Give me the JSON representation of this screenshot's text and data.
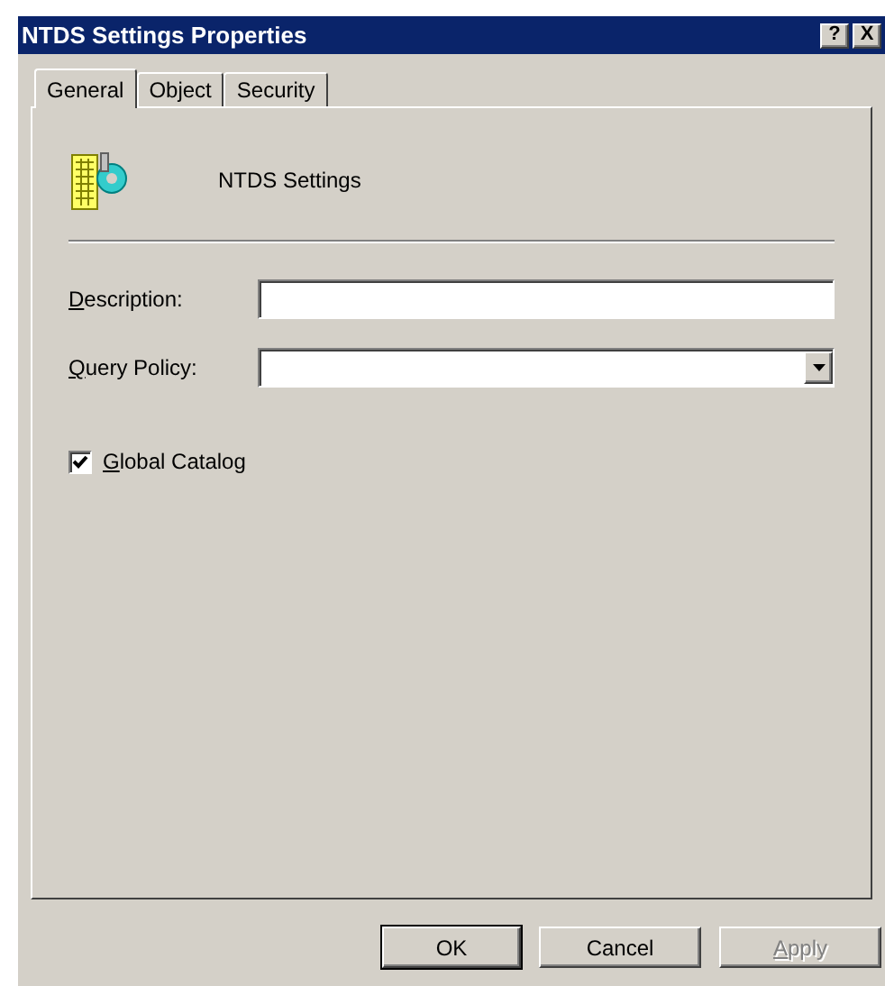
{
  "window": {
    "title": "NTDS Settings Properties"
  },
  "title_buttons": [
    "?",
    "X"
  ],
  "tabs": [
    {
      "label": "General",
      "selected": true
    },
    {
      "label": "Object",
      "selected": false
    },
    {
      "label": "Security",
      "selected": false
    }
  ],
  "object_name": "NTDS Settings",
  "description": {
    "label": "Description:"
  },
  "query_policy": {
    "label": "Query Policy:"
  },
  "global_catalog": {
    "label": "Global Catalog",
    "checked": true
  },
  "buttons": [
    {
      "label": "OK",
      "default": true,
      "disabled": false
    },
    {
      "label": "Cancel",
      "default": false,
      "disabled": false
    },
    {
      "label": "Apply",
      "default": false,
      "disabled": true
    }
  ]
}
